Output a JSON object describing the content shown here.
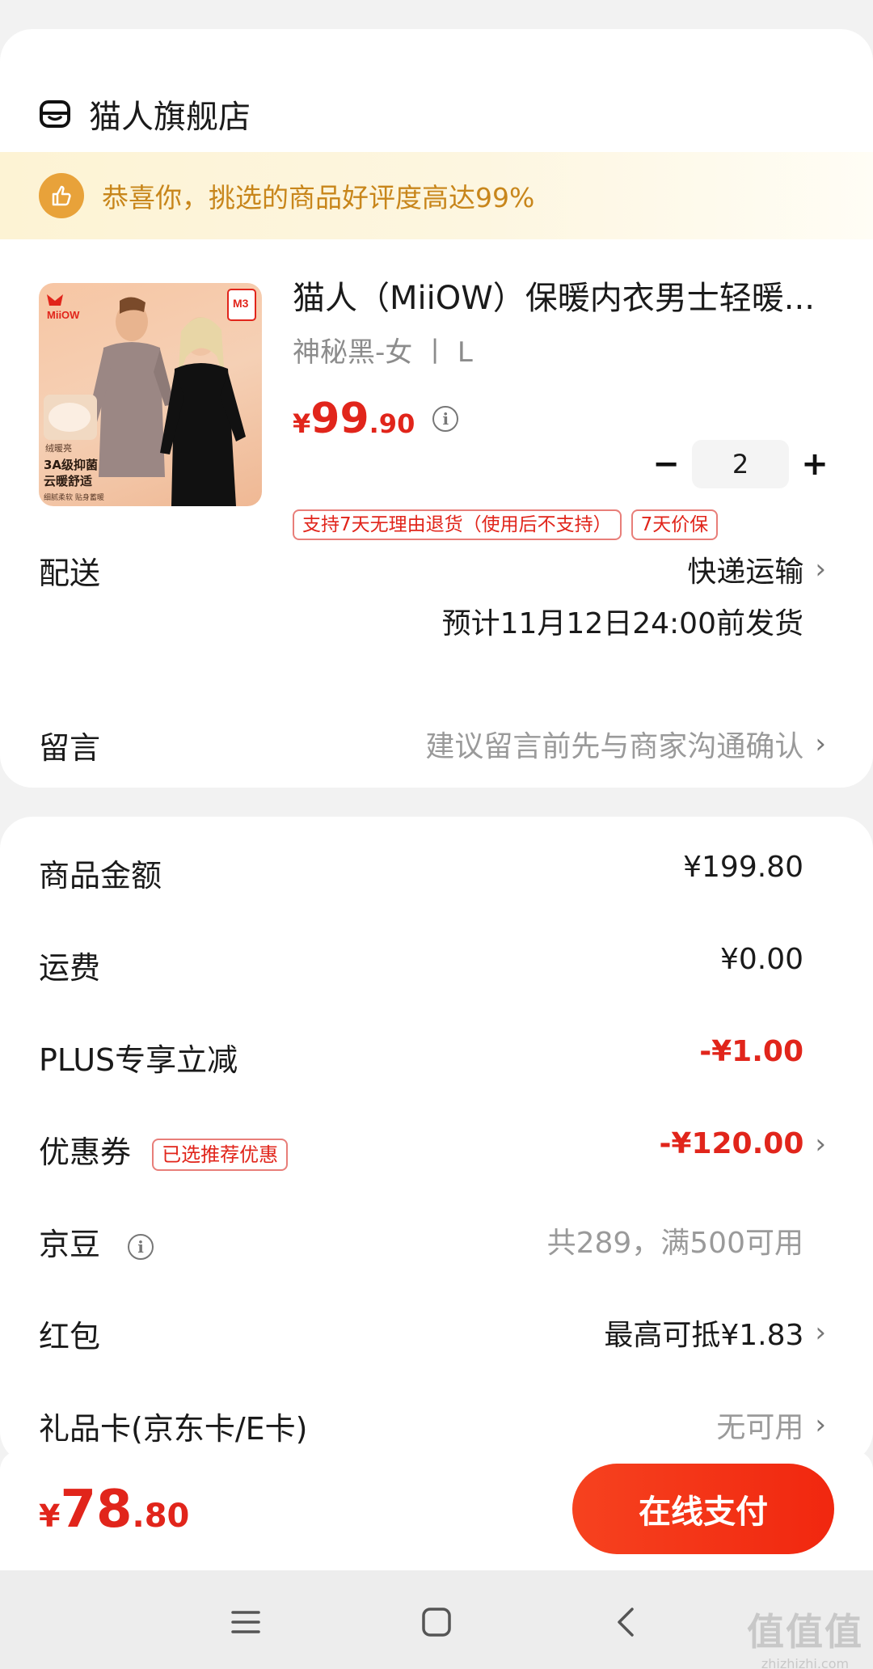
{
  "shop": {
    "name": "猫人旗舰店",
    "banner": "恭喜你，挑选的商品好评度高达99%"
  },
  "product": {
    "title": "猫人（MiiOW）保暖内衣男士轻暖...",
    "spec": "神秘黑-女 丨 L",
    "price_currency": "¥",
    "price_int": "99",
    "price_dec": ".90",
    "quantity": "2",
    "tags": [
      "支持7天无理由退货（使用后不支持）",
      "7天价保"
    ],
    "image_texts": {
      "brand": "MiiOW",
      "badge": "M3",
      "line1": "绒暖亮",
      "line2": "3A级抑菌",
      "line3": "云暖舒适",
      "line4": "细腻柔软 贴身蓄暖"
    }
  },
  "delivery": {
    "label": "配送",
    "method": "快递运输",
    "estimate": "预计11月12日24:00前发货"
  },
  "message": {
    "label": "留言",
    "placeholder": "建议留言前先与商家沟通确认"
  },
  "costs": {
    "goods_label": "商品金额",
    "goods_value": "¥199.80",
    "shipping_label": "运费",
    "shipping_value": "¥0.00",
    "plus_label": "PLUS专享立减",
    "plus_value": "-¥1.00",
    "coupon_label": "优惠券",
    "coupon_tag": "已选推荐优惠",
    "coupon_value": "-¥120.00",
    "jingdou_label": "京豆",
    "jingdou_value": "共289，满500可用",
    "hongbao_label": "红包",
    "hongbao_value": "最高可抵¥1.83",
    "giftcard_label": "礼品卡(京东卡/E卡)",
    "giftcard_value": "无可用"
  },
  "footer": {
    "total_currency": "¥",
    "total_int": "78",
    "total_dec": ".80",
    "pay_button": "在线支付"
  },
  "watermark": {
    "big": "值值值",
    "small": "zhizhizhi.com"
  },
  "colors": {
    "accent_red": "#e1251b",
    "banner_gold": "#c8861b"
  }
}
